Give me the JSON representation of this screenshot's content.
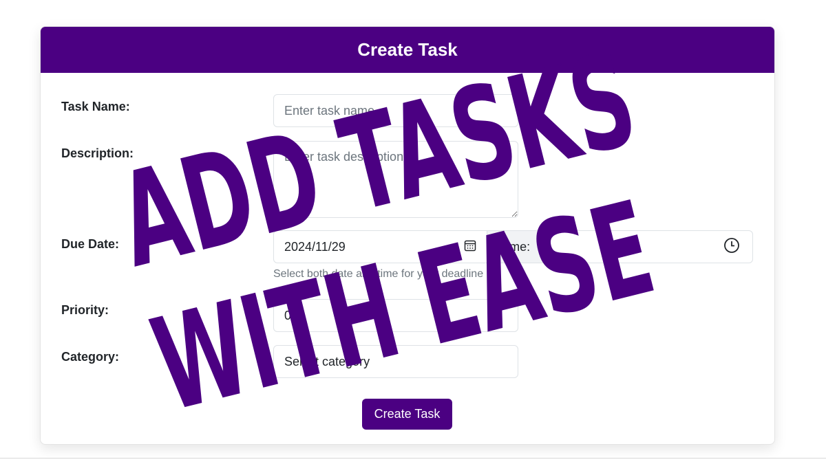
{
  "form": {
    "title": "Create Task",
    "task_name": {
      "label": "Task Name:",
      "placeholder": "Enter task name"
    },
    "description": {
      "label": "Description:",
      "placeholder": "Enter task description"
    },
    "due_date": {
      "label": "Due Date:",
      "date_value": "2024/11/29",
      "time_label": "Time:",
      "time_value": "",
      "help": "Select both date and time for your deadline"
    },
    "priority": {
      "label": "Priority:",
      "value": "0"
    },
    "category": {
      "label": "Category:",
      "selected": "Select category"
    },
    "submit_label": "Create Task"
  },
  "overlay": {
    "line1": "ADD TASKS",
    "line2": "WITH EASE",
    "color": "#4b0082"
  },
  "colors": {
    "accent": "#4b0082"
  },
  "icons": {
    "date": "calendar-icon",
    "time": "clock-icon"
  }
}
